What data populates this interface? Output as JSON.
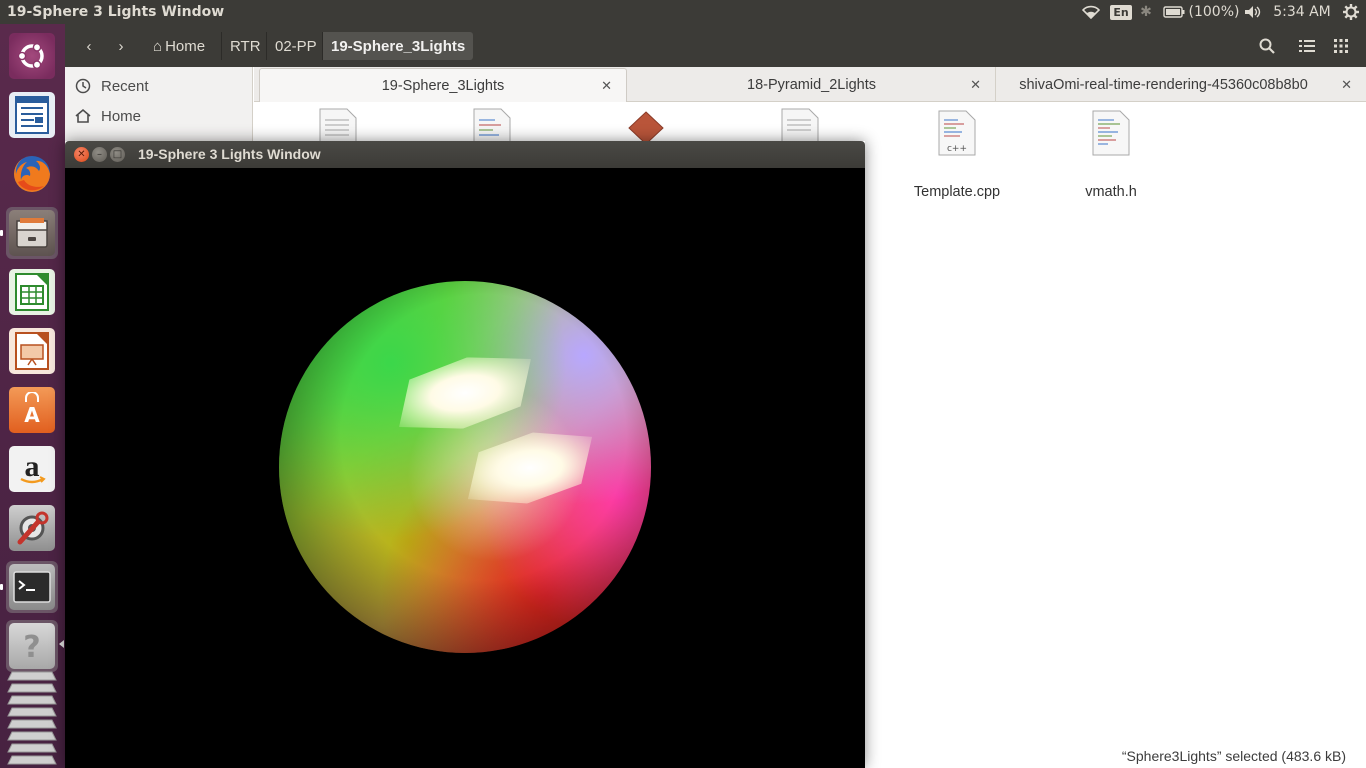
{
  "top_panel": {
    "title": "19-Sphere 3 Lights Window",
    "keyboard": "En",
    "battery_text": "(100%)",
    "time": "5:34 AM"
  },
  "launcher": {
    "items": [
      "ubuntu-dash",
      "libreoffice-writer",
      "firefox",
      "files",
      "libreoffice-calc",
      "libreoffice-impress",
      "ubuntu-software",
      "amazon",
      "system-settings",
      "terminal",
      "help",
      "workspaces"
    ]
  },
  "file_manager": {
    "breadcrumbs": [
      "Home",
      "RTR",
      "02-PP",
      "19-Sphere_3Lights"
    ],
    "sidebar": [
      {
        "label": "Recent",
        "icon": "clock-icon"
      },
      {
        "label": "Home",
        "icon": "home-icon"
      }
    ],
    "tabs": [
      {
        "label": "19-Sphere_3Lights",
        "active": true
      },
      {
        "label": "18-Pyramid_2Lights",
        "active": false
      },
      {
        "label": "shivaOmi-real-time-rendering-45360c08b8b0",
        "active": false
      }
    ],
    "files": [
      {
        "name": "Template.cpp",
        "type": "c++"
      },
      {
        "name": "vmath.h",
        "type": "text"
      }
    ],
    "status": "“Sphere3Lights” selected  (483.6 kB)"
  },
  "gl_window": {
    "title": "19-Sphere 3 Lights Window",
    "background": "#000000"
  }
}
